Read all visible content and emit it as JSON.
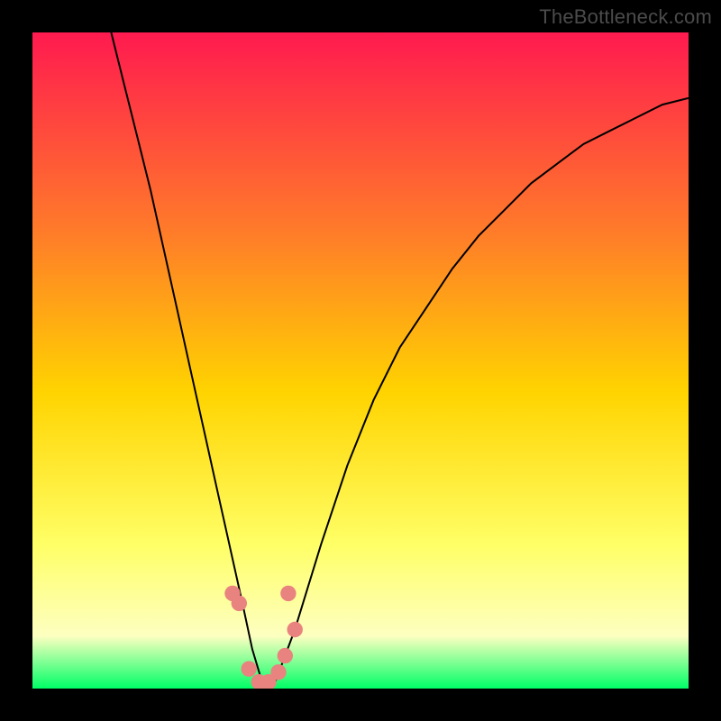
{
  "watermark": "TheBottleneck.com",
  "colors": {
    "frame": "#000000",
    "gradient_top": "#ff1a4f",
    "gradient_mid1": "#ff7a2a",
    "gradient_mid2": "#ffd400",
    "gradient_mid3": "#ffff66",
    "gradient_mid4": "#fdffc0",
    "gradient_bottom": "#00ff66",
    "curve": "#000000",
    "marker": "#e9837f"
  },
  "chart_data": {
    "type": "line",
    "title": "",
    "xlabel": "",
    "ylabel": "",
    "xlim": [
      0,
      100
    ],
    "ylim": [
      0,
      100
    ],
    "series": [
      {
        "name": "bottleneck-curve",
        "x": [
          12,
          14,
          16,
          18,
          20,
          22,
          24,
          26,
          28,
          30,
          32,
          33.5,
          35,
          36,
          37,
          40,
          44,
          48,
          52,
          56,
          60,
          64,
          68,
          72,
          76,
          80,
          84,
          88,
          92,
          96,
          100
        ],
        "y": [
          100,
          92,
          84,
          76,
          67,
          58,
          49,
          40,
          31,
          22,
          13,
          6,
          1,
          0,
          1,
          9,
          22,
          34,
          44,
          52,
          58,
          64,
          69,
          73,
          77,
          80,
          83,
          85,
          87,
          89,
          90
        ]
      }
    ],
    "markers": {
      "name": "highlight-dots",
      "x": [
        30.5,
        31.5,
        33.0,
        34.5,
        36.0,
        37.5,
        38.5,
        39.0,
        40.0
      ],
      "y": [
        14.5,
        13.0,
        3.0,
        1.0,
        1.0,
        2.5,
        5.0,
        14.5,
        9.0
      ],
      "r_plot_units": 1.2
    }
  }
}
